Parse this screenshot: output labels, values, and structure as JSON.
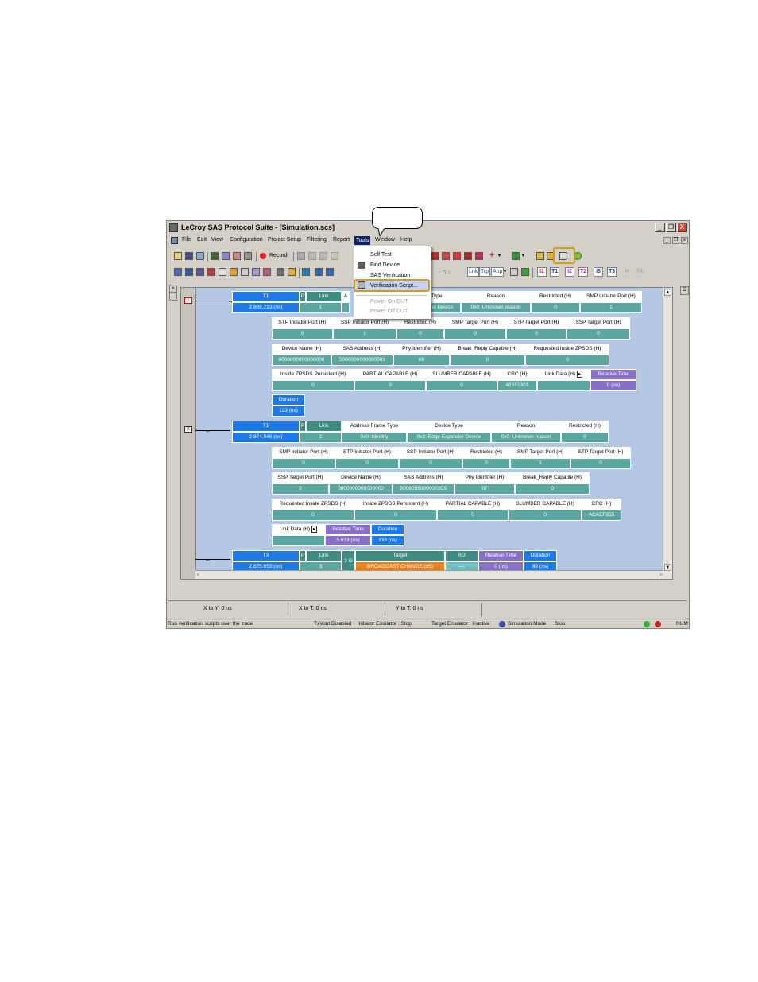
{
  "window": {
    "title": "LeCroy SAS Protocol Suite - [Simulation.scs]",
    "menu": [
      "File",
      "Edit",
      "View",
      "Configuration",
      "Project Setup",
      "Filtering",
      "Report",
      "Tools",
      "Window",
      "Help"
    ],
    "mdi_buttons": [
      "_",
      "❐",
      "x"
    ],
    "buttons": [
      "_",
      "❐",
      "X"
    ]
  },
  "toolbar": {
    "record_label": "Record",
    "layer_buttons": [
      "Lnk",
      "Trp",
      "App"
    ],
    "marker_buttons": [
      "I1",
      "T1",
      "I2",
      "T2",
      "I3",
      "T3",
      "I4",
      "T4"
    ]
  },
  "tools_menu": {
    "items": [
      {
        "label": "Self Test",
        "enabled": true
      },
      {
        "label": "Find Device",
        "enabled": true
      },
      {
        "label": "SAS Verification",
        "enabled": true
      },
      {
        "label": "Verification Script...",
        "enabled": true,
        "highlighted": true
      },
      {
        "label": "Power On DUT",
        "enabled": false
      },
      {
        "label": "Power Off DUT",
        "enabled": false
      }
    ]
  },
  "trace": {
    "packet1": {
      "marker": "T",
      "header": [
        {
          "h": "T1",
          "v": "2.869.213 (ns)"
        },
        {
          "h": "Link",
          "v": "1"
        },
        {
          "h": "e Type",
          "v": "End Device"
        },
        {
          "h": "Reason",
          "v": "0x0: Unknown reason"
        },
        {
          "h": "Restricted (H)",
          "v": "0"
        },
        {
          "h": "SMP Initiator Port (H)",
          "v": "1"
        }
      ],
      "row2": [
        {
          "h": "STP Initiator Port (H)",
          "v": "0"
        },
        {
          "h": "SSP Initiator Port (H)",
          "v": "1"
        },
        {
          "h": "Restricted (H)",
          "v": "0"
        },
        {
          "h": "SMP Target Port (H)",
          "v": "0"
        },
        {
          "h": "STP Target Port (H)",
          "v": "0"
        },
        {
          "h": "SSP Target Port (H)",
          "v": "0"
        }
      ],
      "row3": [
        {
          "h": "Device Name (H)",
          "v": "0000000000000000"
        },
        {
          "h": "SAS Address (H)",
          "v": "5000000000000001"
        },
        {
          "h": "Phy Identifier (H)",
          "v": "00"
        },
        {
          "h": "Break_Reply Capable (H)",
          "v": "0"
        },
        {
          "h": "Requested Inside ZPSDS (H)",
          "v": "0"
        }
      ],
      "row4": [
        {
          "h": "Inside ZPSDS Persistent (H)",
          "v": "0"
        },
        {
          "h": "PARTIAL CAPABLE (H)",
          "v": "0"
        },
        {
          "h": "SLUMBER CAPABLE (H)",
          "v": "0"
        },
        {
          "h": "CRC (H)",
          "v": "41551301"
        },
        {
          "h": "Link Data (H)",
          "v": ""
        },
        {
          "h": "Relative Time",
          "v": "0 (ns)"
        }
      ],
      "row5": [
        {
          "h": "Duration",
          "v": "133 (ns)"
        }
      ]
    },
    "packet2": {
      "marker": "X",
      "header": [
        {
          "h": "T1",
          "v": "2.874.946 (ns)"
        },
        {
          "h": "Link",
          "v": "2"
        },
        {
          "h": "Address Frame Type",
          "v": "0x0: Identify"
        },
        {
          "h": "Device Type",
          "v": "0x2: Edge Expander Device"
        },
        {
          "h": "Reason",
          "v": "0x0: Unknown reason"
        },
        {
          "h": "Restricted (H)",
          "v": "0"
        }
      ],
      "row2": [
        {
          "h": "SMP Initiator Port (H)",
          "v": "0"
        },
        {
          "h": "STP Initiator Port (H)",
          "v": "0"
        },
        {
          "h": "SSP Initiator Port (H)",
          "v": "0"
        },
        {
          "h": "Restricted (H)",
          "v": "0"
        },
        {
          "h": "SMP Target Port (H)",
          "v": "1"
        },
        {
          "h": "STP Target Port (H)",
          "v": "0"
        }
      ],
      "row3": [
        {
          "h": "SSP Target Port (H)",
          "v": "0"
        },
        {
          "h": "Device Name (H)",
          "v": "0000000000000000"
        },
        {
          "h": "SAS Address (H)",
          "v": "50060560000003C5"
        },
        {
          "h": "Phy Identifier (H)",
          "v": "07"
        },
        {
          "h": "Break_Reply Capable (H)",
          "v": "0"
        }
      ],
      "row4": [
        {
          "h": "Requested Inside ZPSDS (H)",
          "v": "0"
        },
        {
          "h": "Inside ZPSDS Persistent (H)",
          "v": "0"
        },
        {
          "h": "PARTIAL CAPABLE (H)",
          "v": "0"
        },
        {
          "h": "SLUMBER CAPABLE (H)",
          "v": "0"
        },
        {
          "h": "CRC (H)",
          "v": "ACAEF855"
        }
      ],
      "row5": [
        {
          "h": "Link Data (H)",
          "v": ""
        },
        {
          "h": "Relative Time",
          "v": "5.833 (us)"
        },
        {
          "h": "Duration",
          "v": "133 (ns)"
        }
      ]
    },
    "packet3": {
      "header": [
        {
          "h": "T3",
          "v": "2.875.653 (ns)"
        },
        {
          "h": "Link",
          "v": "3"
        },
        {
          "h": "",
          "v": "3 G"
        },
        {
          "h": "Target",
          "v": "BROADCAST CHANGE (x5)"
        },
        {
          "h": "RD",
          "v": "----"
        },
        {
          "h": "Relative Time",
          "v": "0 (ns)"
        },
        {
          "h": "Duration",
          "v": "80 (ns)"
        }
      ]
    }
  },
  "cursor_bar": {
    "x_to_y": "X to Y: 0 ns",
    "x_to_t": "X to T: 0 ns",
    "y_to_t": "Y to T: 0 ns"
  },
  "status": {
    "hint": "Run verification scripts over the trace",
    "txvout": "TxVout Disabled",
    "initiator": "Initiator Emulator : Stop",
    "target": "Target Emulator : Inactive",
    "mode": "Simulation Mode",
    "state": "Stop",
    "num": "NUM"
  },
  "colors": {
    "header_cell": "#ffffff",
    "value_cell": "#5aa6a0",
    "time_cell": "#1e78e6",
    "purple_cell": "#8870c8",
    "orange_cell": "#e8821e",
    "callout_highlight": "#d99b13"
  }
}
